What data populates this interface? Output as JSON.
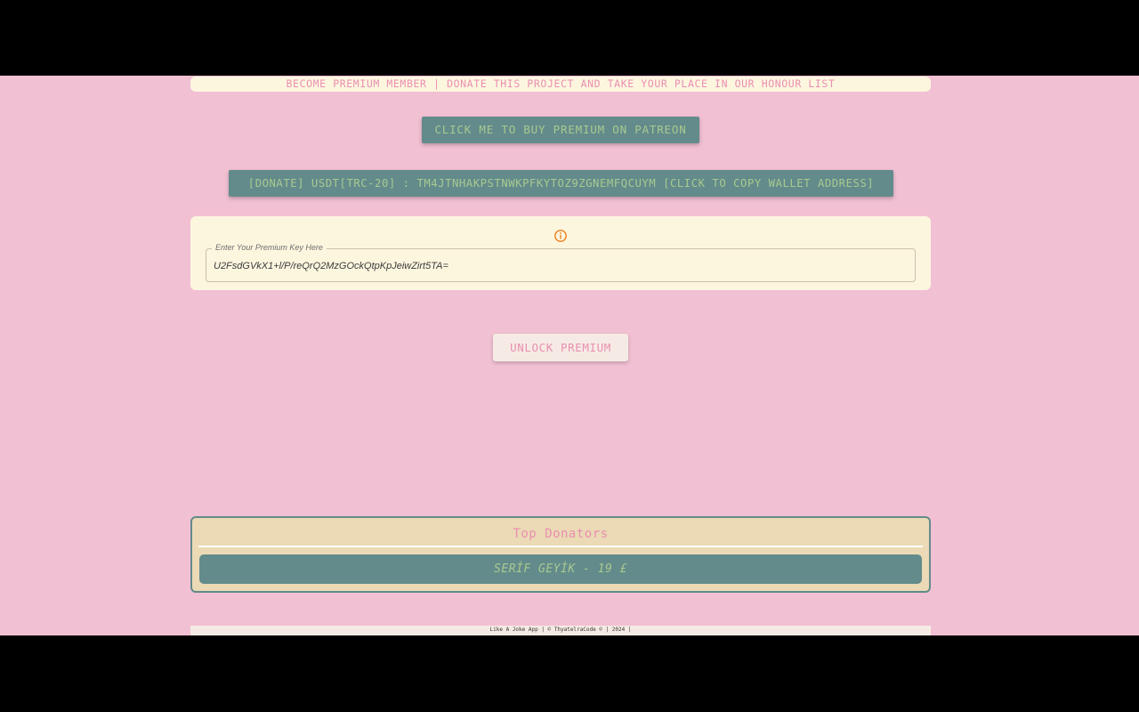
{
  "banner": {
    "text": "BECOME PREMIUM MEMBER | DONATE THIS PROJECT AND TAKE YOUR PLACE IN OUR HONOUR LIST"
  },
  "patreon_button": {
    "label": "CLICK ME TO BUY PREMIUM ON PATREON"
  },
  "wallet_button": {
    "label": "[DONATE] USDT[TRC-20] : TM4JTNHAKPSTNWKPFKYTOZ9ZGNEMFQCUYM [CLICK TO COPY WALLET ADDRESS]"
  },
  "premium_key": {
    "legend": "Enter Your Premium Key Here",
    "value": "U2FsdGVkX1+l/P/reQrQ2MzGOckQtpKpJeiwZirt5TA="
  },
  "unlock_button": {
    "label": "UNLOCK PREMIUM"
  },
  "donators": {
    "title": "Top Donators",
    "items": [
      {
        "label": "SERİF GEYİK - 19 £"
      }
    ]
  },
  "footer": {
    "text": "Like A Joke App | © ThyatelraCode © | 2024 |"
  },
  "colors": {
    "page_background": "#f1c0d3",
    "accent_teal": "#638b8b",
    "accent_pink": "#e98fb1",
    "accent_green_text": "#a8c990",
    "card_cream": "#fdf6df",
    "info_icon": "#ef7d1a"
  },
  "icons": {
    "info": "info-circle-icon"
  }
}
